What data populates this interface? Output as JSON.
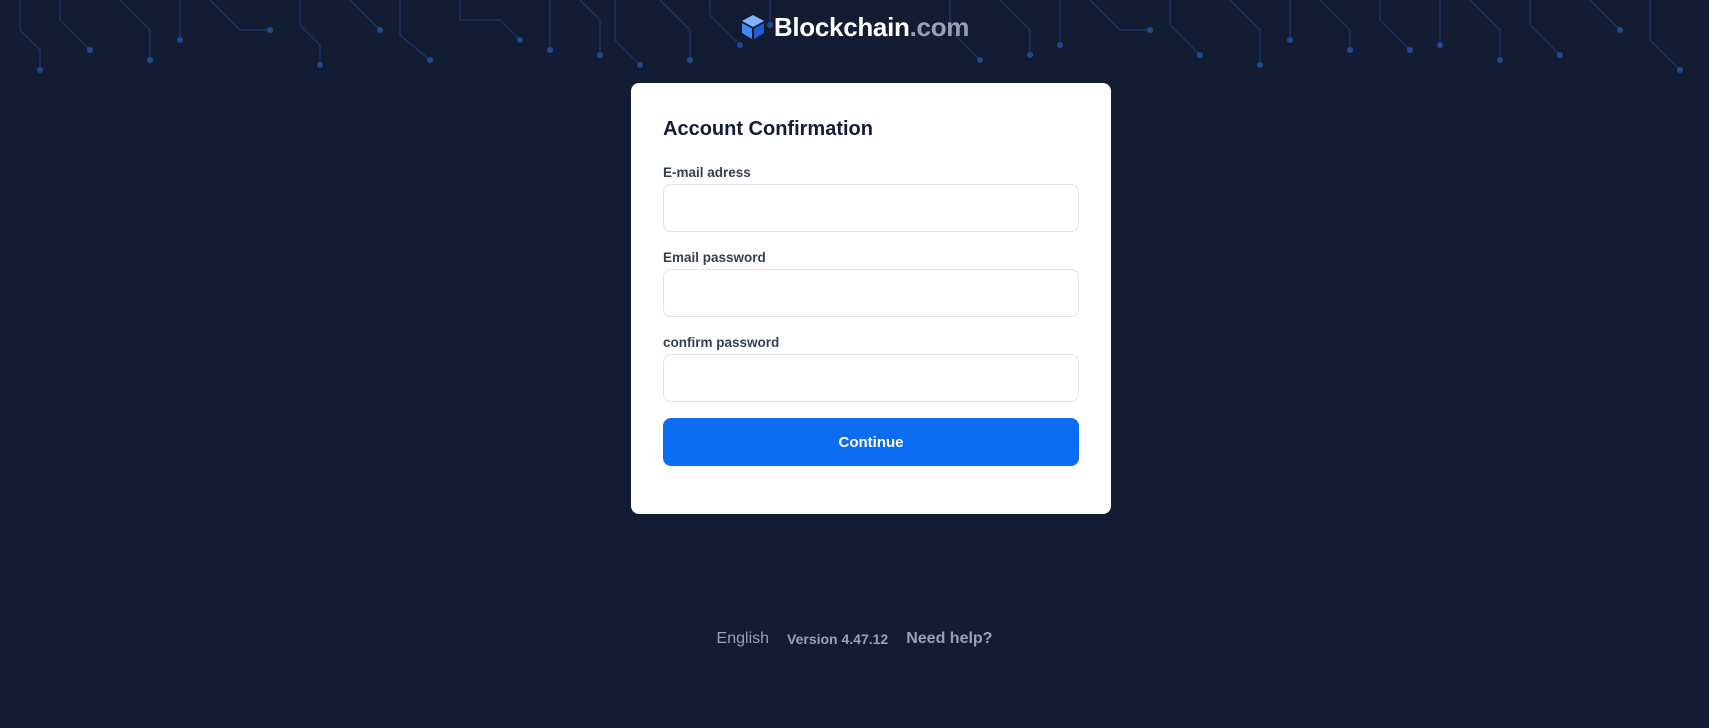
{
  "header": {
    "logo_main": "Blockchain",
    "logo_suffix": ".com",
    "logo_icon": "blockchain-cube-icon"
  },
  "form": {
    "title": "Account Confirmation",
    "fields": [
      {
        "label": "E-mail adress",
        "value": "",
        "placeholder": ""
      },
      {
        "label": "Email password",
        "value": "",
        "placeholder": ""
      },
      {
        "label": "confirm password",
        "value": "",
        "placeholder": ""
      }
    ],
    "submit_label": "Continue"
  },
  "footer": {
    "language": "English",
    "version": "Version 4.47.12",
    "help": "Need help?"
  },
  "colors": {
    "background": "#121d33",
    "accent": "#0c6cf2",
    "card": "#ffffff",
    "muted_text": "#98a1b2"
  }
}
